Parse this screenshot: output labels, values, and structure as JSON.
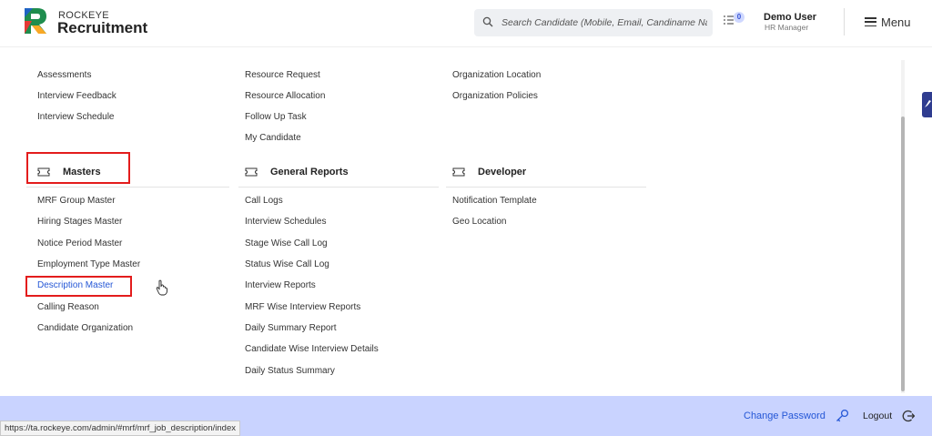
{
  "brand": {
    "top": "ROCKEYE",
    "main": "Recruitment"
  },
  "search": {
    "placeholder": "Search Candidate (Mobile, Email, Candiname Name)"
  },
  "notifications": {
    "count": "0"
  },
  "user": {
    "name": "Demo User",
    "role": "HR Manager"
  },
  "menu_label": "Menu",
  "col1": {
    "top_links": [
      "Assessments",
      "Interview Feedback",
      "Interview Schedule"
    ],
    "section": "Masters",
    "links": [
      "MRF Group Master",
      "Hiring Stages Master",
      "Notice Period Master",
      "Employment Type Master",
      "Description Master",
      "Calling Reason",
      "Candidate Organization"
    ],
    "active_link": "Description Master"
  },
  "col2": {
    "top_links": [
      "Resource Request",
      "Resource Allocation",
      "Follow Up Task",
      "My Candidate"
    ],
    "section": "General Reports",
    "links": [
      "Call Logs",
      "Interview Schedules",
      "Stage Wise Call Log",
      "Status Wise Call Log",
      "Interview Reports",
      "MRF Wise Interview Reports",
      "Daily Summary Report",
      "Candidate Wise Interview Details",
      "Daily Status Summary"
    ]
  },
  "col3": {
    "top_links": [
      "Organization Location",
      "Organization Policies"
    ],
    "section": "Developer",
    "links": [
      "Notification Template",
      "Geo Location"
    ]
  },
  "footer": {
    "change_password": "Change Password",
    "logout": "Logout"
  },
  "status_url": "https://ta.rockeye.com/admin/#mrf/mrf_job_description/index",
  "colors": {
    "accent": "#2557d6",
    "footer_bg": "#c9d3ff",
    "highlight": "#e31c1c"
  }
}
